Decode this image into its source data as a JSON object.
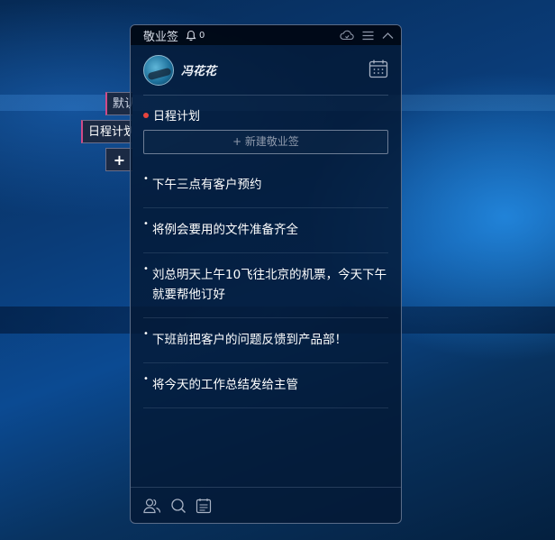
{
  "app": {
    "title": "敬业签",
    "notification_count": "0"
  },
  "side_tabs": [
    {
      "label": "默认"
    },
    {
      "label": "日程计划"
    },
    {
      "label": "+"
    }
  ],
  "profile": {
    "username": "冯花花"
  },
  "section": {
    "title": "日程计划",
    "new_button_label": "+ 新建敬业签"
  },
  "notes": [
    {
      "text": "下午三点有客户预约"
    },
    {
      "text": "将例会要用的文件准备齐全"
    },
    {
      "text": "刘总明天上午10飞往北京的机票，今天下午就要帮他订好"
    },
    {
      "text": "下班前把客户的问题反馈到产品部！"
    },
    {
      "text": "将今天的工作总结发给主管"
    }
  ],
  "colors": {
    "accent_dot": "#e8443d",
    "tab_accent": "#d04a88"
  },
  "icons": {
    "titlebar": [
      "bell-icon",
      "cloud-sync-icon",
      "menu-icon",
      "collapse-icon"
    ],
    "profile": [
      "calendar-icon"
    ],
    "footer": [
      "contacts-icon",
      "search-icon",
      "notes-list-icon"
    ]
  }
}
